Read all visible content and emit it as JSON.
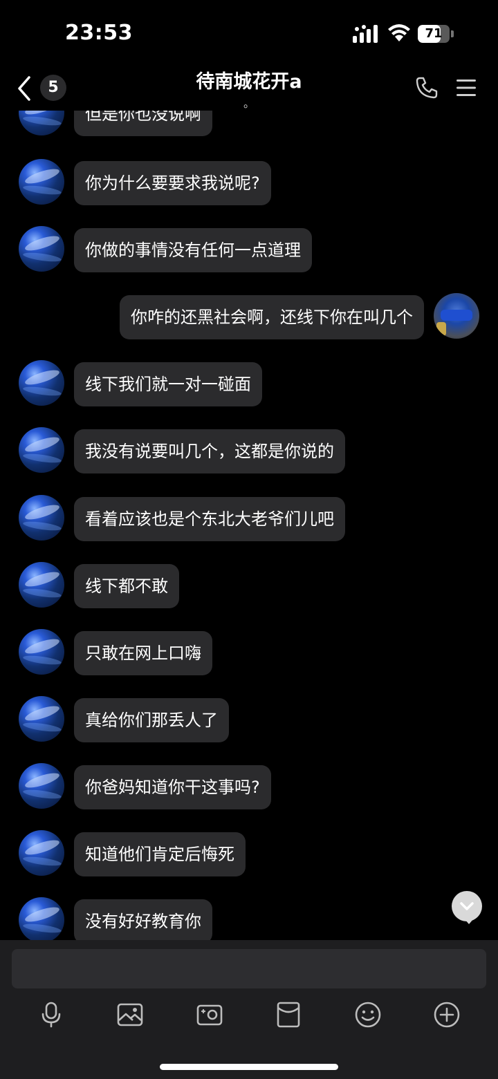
{
  "status_bar": {
    "time": "23:53",
    "battery": "71",
    "battery_level": 0.71
  },
  "header": {
    "unread_count": "5",
    "title": "待南城花开a",
    "subtitle": "。"
  },
  "messages": [
    {
      "text": "但是你也没说啊"
    },
    {
      "text": "你为什么要要求我说呢?"
    },
    {
      "text": "你做的事情没有任何一点道理"
    },
    {
      "text": "你咋的还黑社会啊，还线下你在叫几个"
    },
    {
      "text": "线下我们就一对一碰面"
    },
    {
      "text": "我没有说要叫几个，这都是你说的"
    },
    {
      "text": "看着应该也是个东北大老爷们儿吧"
    },
    {
      "text": "线下都不敢"
    },
    {
      "text": "只敢在网上口嗨"
    },
    {
      "text": "真给你们那丢人了"
    },
    {
      "text": "你爸妈知道你干这事吗?"
    },
    {
      "text": "知道他们肯定后悔死"
    },
    {
      "text": "没有好好教育你"
    }
  ],
  "composer": {
    "input_value": "",
    "input_placeholder": ""
  },
  "icons": {
    "back": "back-chevron-icon",
    "phone": "phone-icon",
    "menu": "menu-icon",
    "voice": "microphone-icon",
    "image": "image-icon",
    "camera": "camera-icon",
    "red_packet": "red-packet-icon",
    "emoji": "emoji-icon",
    "more": "plus-icon",
    "scroll": "chevron-down-icon"
  }
}
